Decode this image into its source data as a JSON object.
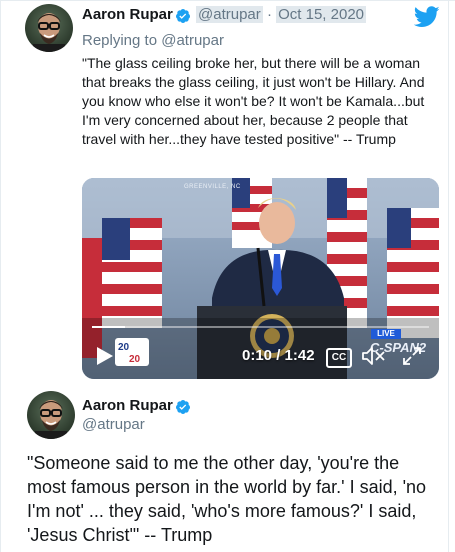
{
  "tweet": {
    "name": "Aaron Rupar",
    "handle": "@atrupar",
    "separator": "·",
    "date": "Oct 15, 2020",
    "replying_prefix": "Replying to",
    "replying_mention": "@atrupar",
    "text": "\"The glass ceiling broke her, but there will be a woman that breaks the glass ceiling, it just won't be Hillary. And you know who else it won't be? It won't be Kamala...but I'm very concerned about her, because 2 people that travel with her...they have tested positive\" -- Trump",
    "icons": {
      "verified": "verified-badge-icon",
      "brand": "twitter-bird-icon"
    }
  },
  "video": {
    "time": "0:10 / 1:42",
    "progress": 0.098,
    "cc_label": "CC",
    "overlay_location": "GREENVILLE, NC",
    "live_badge": "LIVE",
    "network": "C-SPAN2",
    "icons": {
      "play": "play-icon",
      "mute": "muted-speaker-icon",
      "fullscreen": "fullscreen-icon"
    }
  },
  "tweet2": {
    "name": "Aaron Rupar",
    "handle": "@atrupar",
    "text": "\"Someone said to me the other day, 'you're the most famous person in the world by far.' I said, 'no I'm not' ... they said, 'who's more famous?' I said, 'Jesus Christ'\" -- Trump"
  },
  "colors": {
    "twitter_blue": "#1da1f2",
    "text": "#14171a",
    "muted": "#657786"
  }
}
